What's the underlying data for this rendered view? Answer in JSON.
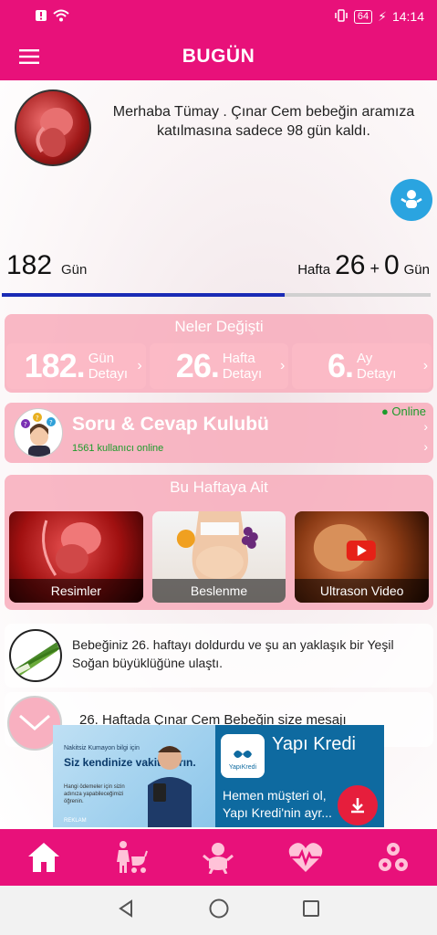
{
  "status_bar": {
    "battery": "64",
    "time": "14:14"
  },
  "header": {
    "title": "BUGÜN"
  },
  "greeting": {
    "text": "Merhaba Tümay . Çınar Cem bebeğin aramıza katılmasına sadece 98 gün kaldı."
  },
  "counter": {
    "days_value": "182",
    "days_label": "Gün",
    "week_label": "Hafta",
    "week_value": "26",
    "plus": "+",
    "extra_days": "0",
    "extra_days_label": "Gün",
    "progress_fraction": 0.66
  },
  "changes": {
    "title": "Neler Değişti",
    "tiles": [
      {
        "number": "182.",
        "line1": "Gün",
        "line2": "Detayı"
      },
      {
        "number": "26.",
        "line1": "Hafta",
        "line2": "Detayı"
      },
      {
        "number": "6.",
        "line1": "Ay",
        "line2": "Detayı"
      }
    ]
  },
  "qa": {
    "title": "Soru & Cevap Kulubü",
    "users": "1561 kullanıcı online",
    "status": "● Online"
  },
  "week": {
    "title": "Bu Haftaya Ait",
    "items": [
      {
        "label": "Resimler"
      },
      {
        "label": "Beslenme"
      },
      {
        "label": "Ultrason Video"
      }
    ]
  },
  "size_info": {
    "text": "Bebeğiniz 26. haftayı doldurdu ve şu an yaklaşık bir Yeşil Soğan büyüklüğüne ulaştı."
  },
  "message": {
    "text": "26. Haftada Çınar Cem Bebeğin size mesajı"
  },
  "ad": {
    "small_top": "Nakitsiz Kuma­yon bilgi için",
    "headline": "Siz kendinize vakit ayırın.",
    "fine_print": "Hangi ödeme­ler için siz­in adınıza yap­abileceğimizi öğrenin.",
    "ad_tag": "REKLAM",
    "brand": "Yapı Kredi",
    "logo_text": "YapıKredi",
    "description": "Hemen müşteri ol, Yapı Kredi'nin ayr...",
    "accent": "#e61e3c"
  },
  "colors": {
    "primary": "#e8117a",
    "card_pink": "#f8aaba",
    "progress": "#1a2bb5",
    "online_green": "#1d9b2b",
    "fab_blue": "#2aa4e0"
  },
  "nav": {
    "items": [
      {
        "icon": "home-icon"
      },
      {
        "icon": "mother-stroller-icon"
      },
      {
        "icon": "baby-icon"
      },
      {
        "icon": "heart-pulse-icon"
      },
      {
        "icon": "settings-gears-icon"
      }
    ]
  }
}
